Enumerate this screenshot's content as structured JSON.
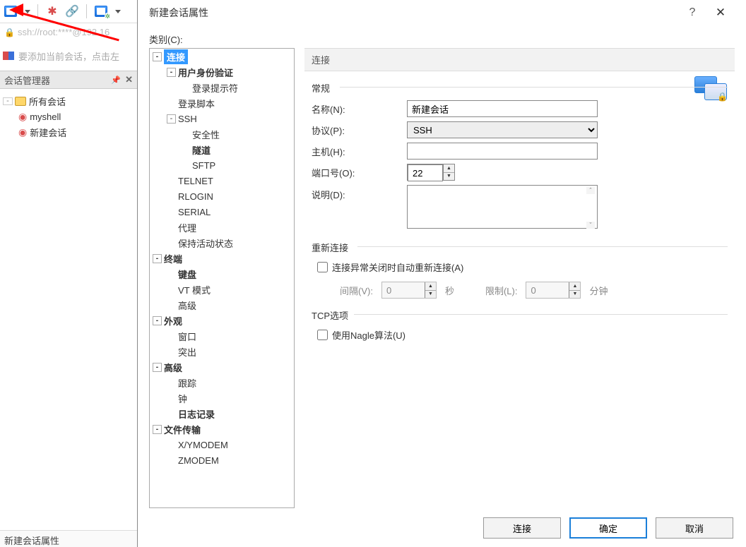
{
  "bg": {
    "url_text": "ssh://root:****@192.16",
    "add_tip": "要添加当前会话，点击左",
    "panel_title": "会话管理器",
    "all_sessions": "所有会话",
    "myshell": "myshell",
    "new_session": "新建会话",
    "status": "新建会话属性"
  },
  "dialog": {
    "title": "新建会话属性",
    "help": "?",
    "close": "✕",
    "category_label": "类别(C):",
    "section_header": "连接",
    "footer": {
      "connect": "连接",
      "ok": "确定",
      "cancel": "取消"
    }
  },
  "tree": {
    "connection": "连接",
    "auth": "用户身份验证",
    "login_prompt": "登录提示符",
    "login_script": "登录脚本",
    "ssh": "SSH",
    "security": "安全性",
    "tunnel": "隧道",
    "sftp": "SFTP",
    "telnet": "TELNET",
    "rlogin": "RLOGIN",
    "serial": "SERIAL",
    "proxy": "代理",
    "keepalive": "保持活动状态",
    "terminal": "终端",
    "keyboard": "键盘",
    "vtmode": "VT 模式",
    "adv_term": "高级",
    "appearance": "外观",
    "window": "窗口",
    "highlight": "突出",
    "advanced": "高级",
    "trace": "跟踪",
    "bell": "钟",
    "logging": "日志记录",
    "filetransfer": "文件传输",
    "xymodem": "X/YMODEM",
    "zmodem": "ZMODEM"
  },
  "form": {
    "group_general": "常规",
    "name_label": "名称(N):",
    "name_value": "新建会话",
    "protocol_label": "协议(P):",
    "protocol_value": "SSH",
    "host_label": "主机(H):",
    "host_value": "",
    "port_label": "端口号(O):",
    "port_value": "22",
    "desc_label": "说明(D):",
    "desc_value": "",
    "group_reconnect": "重新连接",
    "reconnect_chk": "连接异常关闭时自动重新连接(A)",
    "interval_label": "间隔(V):",
    "interval_value": "0",
    "seconds_label": "秒",
    "limit_label": "限制(L):",
    "limit_value": "0",
    "minutes_label": "分钟",
    "group_tcp": "TCP选项",
    "nagle_chk": "使用Nagle算法(U)"
  }
}
